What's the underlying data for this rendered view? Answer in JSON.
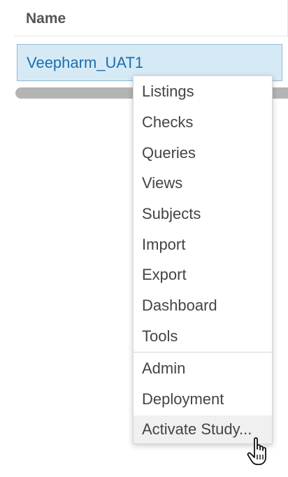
{
  "table": {
    "column_name": "Name",
    "selected_study": "Veepharm_UAT1"
  },
  "context_menu": {
    "items": [
      {
        "label": "Listings"
      },
      {
        "label": "Checks"
      },
      {
        "label": "Queries"
      },
      {
        "label": "Views"
      },
      {
        "label": "Subjects"
      },
      {
        "label": "Import"
      },
      {
        "label": "Export"
      },
      {
        "label": "Dashboard"
      },
      {
        "label": "Tools"
      },
      {
        "label": "Admin"
      },
      {
        "label": "Deployment"
      },
      {
        "label": "Activate Study..."
      }
    ],
    "hovered_item": "Activate Study..."
  },
  "colors": {
    "selection_bg": "#d6eaf6",
    "link_text": "#1a6fb0",
    "menu_text": "#444444"
  },
  "icons": {
    "cursor": "hand-pointer-icon"
  }
}
